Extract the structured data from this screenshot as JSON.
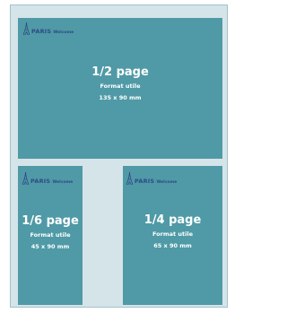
{
  "colors": {
    "page_background": "#d5e4e9",
    "ad_block": "#4f9aa6",
    "logo": "#2e4a86",
    "text": "#ffffff"
  },
  "logo": {
    "icon": "eiffel-tower-icon",
    "paris": "PARIS",
    "welcome": "Welcome"
  },
  "formats": [
    {
      "size": "1/2 page",
      "label": "Format utile",
      "dimensions": "135 x 90 mm"
    },
    {
      "size": "1/6 page",
      "label": "Format utile",
      "dimensions": "45 x 90 mm"
    },
    {
      "size": "1/4 page",
      "label": "Format utile",
      "dimensions": "65 x 90 mm"
    }
  ]
}
